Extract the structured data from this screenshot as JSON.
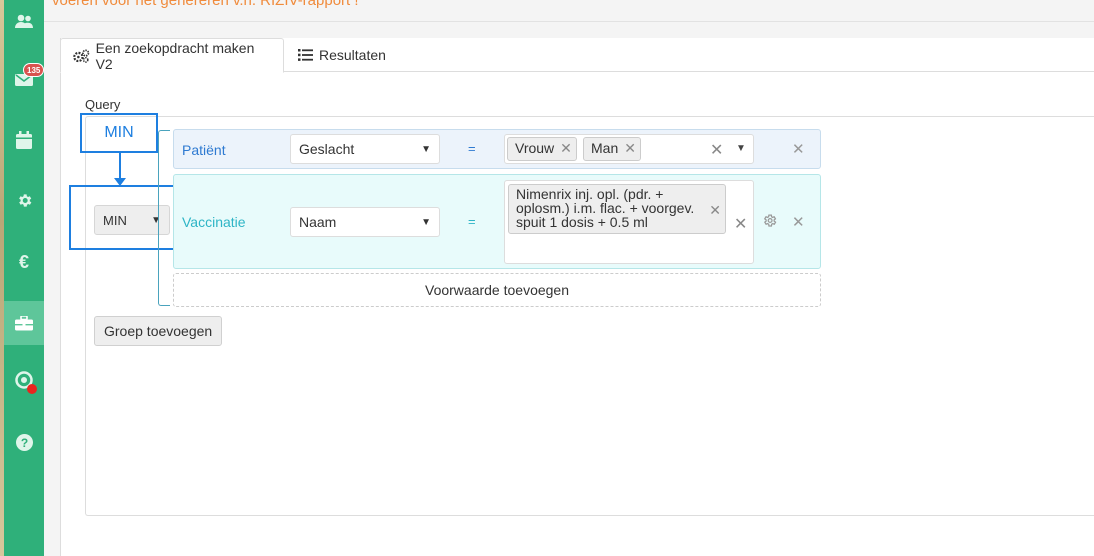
{
  "top_banner": {
    "text": "voeren voor het genereren v.h. RIZIV-rapport !"
  },
  "sidebar": {
    "accent": "#2fb07a",
    "items": [
      {
        "icon": "users-icon"
      },
      {
        "icon": "mail-icon",
        "badge": "135"
      },
      {
        "icon": "calendar-icon"
      },
      {
        "icon": "gear-icon"
      },
      {
        "icon": "euro-icon"
      },
      {
        "icon": "toolbox-icon",
        "active": true
      },
      {
        "icon": "support-icon",
        "status": "red-dot"
      },
      {
        "icon": "help-icon"
      }
    ]
  },
  "tabs": [
    {
      "label": "Een zoekopdracht maken V2",
      "icon": "cogs-icon",
      "active": true
    },
    {
      "label": "Resultaten",
      "icon": "list-icon",
      "active": false
    }
  ],
  "query": {
    "label": "Query",
    "annotation_label": "MIN",
    "aggregate": "MIN",
    "conditions": [
      {
        "entity": "Patiënt",
        "field": "Geslacht",
        "operator": "=",
        "values": [
          "Vrouw",
          "Man"
        ]
      },
      {
        "entity": "Vaccinatie",
        "field": "Naam",
        "operator": "=",
        "values": [
          "Nimenrix inj. opl. (pdr. + oplosm.) i.m. flac. + voorgev. spuit 1 dosis + 0.5 ml"
        ]
      }
    ],
    "add_condition_label": "Voorwaarde toevoegen",
    "add_group_label": "Groep toevoegen"
  },
  "colors": {
    "annotation": "#1e7fe0",
    "banner_text": "#f08b3c",
    "patient_row": "#ecf3fb",
    "vaccination_row": "#e8fbfb"
  }
}
